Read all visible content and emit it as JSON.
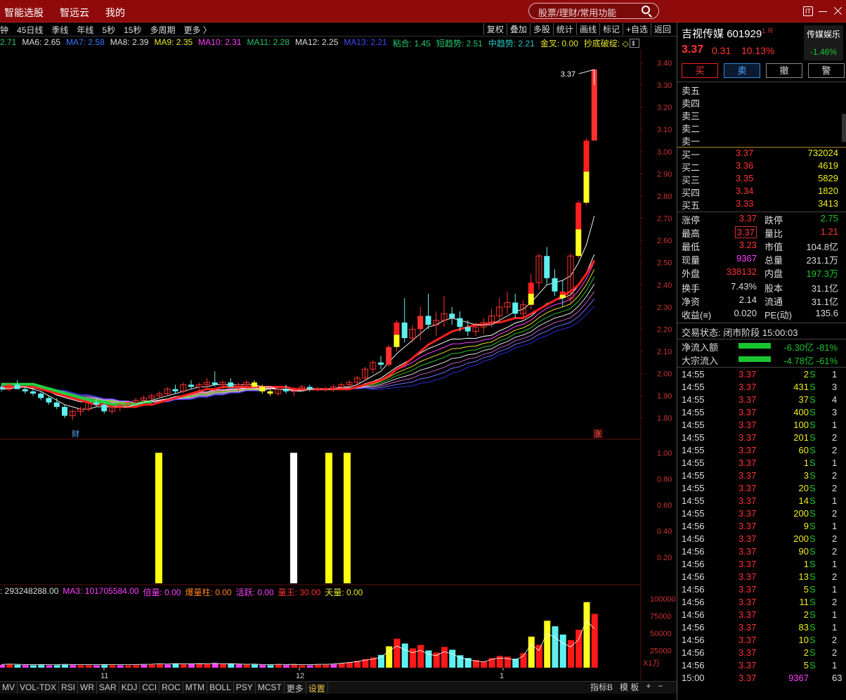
{
  "topbar": {
    "menu": [
      "智能选股",
      "智远云",
      "我的"
    ],
    "search_placeholder": "股票/理财/常用功能",
    "icon_label": "IT"
  },
  "chart_toolbar": {
    "left": [
      "钟",
      "45日线",
      "季线",
      "年线",
      "5秒",
      "15秒",
      "多周期",
      "更多 〉"
    ],
    "right": [
      "复权",
      "叠加",
      "多股",
      "统计",
      "画线",
      "标记",
      "+自选",
      "返回"
    ]
  },
  "ma_line": [
    {
      "text": "2.71",
      "color": "#27c56b"
    },
    {
      "text": "MA6: 2.65",
      "color": "#dddddd"
    },
    {
      "text": "MA7: 2.58",
      "color": "#3a78ff"
    },
    {
      "text": "MA8: 2.39",
      "color": "#dddddd"
    },
    {
      "text": "MA9: 2.35",
      "color": "#e8e830"
    },
    {
      "text": "MA10: 2.31",
      "color": "#ff40ff"
    },
    {
      "text": "MA11: 2.28",
      "color": "#27c56b"
    },
    {
      "text": "MA12: 2.25",
      "color": "#dddddd"
    },
    {
      "text": "MA13: 2.21",
      "color": "#3a4cff"
    },
    {
      "text": "粘合: 1.45",
      "color": "#27c56b"
    },
    {
      "text": "短趋势: 2.51",
      "color": "#27c56b"
    },
    {
      "text": "中趋势: 2.21",
      "color": "#27c5c5"
    },
    {
      "text": "金叉: 0.00",
      "color": "#e8e830"
    },
    {
      "text": "抄底破绽: ◇",
      "color": "#e8e830"
    }
  ],
  "price_axis": [
    "3.40",
    "3.30",
    "3.20",
    "3.10",
    "3.00",
    "2.90",
    "2.80",
    "2.70",
    "2.60",
    "2.50",
    "2.40",
    "2.30",
    "2.20",
    "2.10",
    "2.00",
    "1.90",
    "1.80"
  ],
  "signal_axis": [
    "1.00",
    "0.80",
    "0.60",
    "0.40",
    "0.20"
  ],
  "volume_axis": [
    "100000",
    "75000",
    "50000",
    "25000"
  ],
  "volume_unit": "X1万",
  "month_labels": [
    "11",
    "12",
    "1"
  ],
  "price_callout": "3.37",
  "badge_finance": "财",
  "badge_up": "涨",
  "indicator_line": [
    {
      "text": ": 293248288.00",
      "color": "#dddddd"
    },
    {
      "text": "MA3: 101705584.00",
      "color": "#ff40ff"
    },
    {
      "text": "倍量: 0.00",
      "color": "#ff40ff"
    },
    {
      "text": "爆量柱: 0.00",
      "color": "#ff8020"
    },
    {
      "text": "活跃: 0.00",
      "color": "#ff40ff"
    },
    {
      "text": "量王: 30.00",
      "color": "#ff3030"
    },
    {
      "text": "天量: 0.00",
      "color": "#e8e830"
    }
  ],
  "bottom_tabs": [
    "MV",
    "VOL-TDX",
    "RSI",
    "WR",
    "SAR",
    "KDJ",
    "CCI",
    "ROC",
    "MTM",
    "BOLL",
    "PSY",
    "MCST",
    "更多",
    "设置"
  ],
  "bottom_right": [
    "指标B",
    "模 板",
    "+",
    "−"
  ],
  "stock": {
    "name": "吉视传媒",
    "code": "601929",
    "flags": "L R",
    "price": "3.37",
    "change": "0.31",
    "change_pct": "10.13%",
    "sector_name": "传媒娱乐",
    "sector_pct": "-1.46%"
  },
  "trade_buttons": [
    "买",
    "卖",
    "撤",
    "警"
  ],
  "asks": [
    {
      "label": "卖五",
      "price": "",
      "vol": ""
    },
    {
      "label": "卖四",
      "price": "",
      "vol": ""
    },
    {
      "label": "卖三",
      "price": "",
      "vol": ""
    },
    {
      "label": "卖二",
      "price": "",
      "vol": ""
    },
    {
      "label": "卖一",
      "price": "",
      "vol": ""
    }
  ],
  "bids": [
    {
      "label": "买一",
      "price": "3.37",
      "vol": "732024"
    },
    {
      "label": "买二",
      "price": "3.36",
      "vol": "4619"
    },
    {
      "label": "买三",
      "price": "3.35",
      "vol": "5829"
    },
    {
      "label": "买四",
      "price": "3.34",
      "vol": "1820"
    },
    {
      "label": "买五",
      "price": "3.33",
      "vol": "3413"
    }
  ],
  "stats": [
    {
      "a": "涨停",
      "av": "3.37",
      "ac": "#ff3333",
      "b": "跌停",
      "bv": "2.75",
      "bc": "#19c52f"
    },
    {
      "a": "最高",
      "av": "3.37",
      "ac": "#ff3333",
      "b": "量比",
      "bv": "1.21",
      "bc": "#ff3333"
    },
    {
      "a": "最低",
      "av": "3.23",
      "ac": "#ff3333",
      "b": "市值",
      "bv": "104.8亿",
      "bc": "#dddddd"
    },
    {
      "a": "现量",
      "av": "9367",
      "ac": "#ff40ff",
      "b": "总量",
      "bv": "231.1万",
      "bc": "#dddddd"
    },
    {
      "a": "外盘",
      "av": "338132",
      "ac": "#ff3333",
      "b": "内盘",
      "bv": "197.3万",
      "bc": "#19c52f"
    },
    {
      "a": "换手",
      "av": "7.43%",
      "ac": "#dddddd",
      "b": "股本",
      "bv": "31.1亿",
      "bc": "#dddddd"
    },
    {
      "a": "净资",
      "av": "2.14",
      "ac": "#dddddd",
      "b": "流通",
      "bv": "31.1亿",
      "bc": "#dddddd"
    },
    {
      "a": "收益(≡)",
      "av": "0.020",
      "ac": "#dddddd",
      "b": "PE(动)",
      "bv": "135.6",
      "bc": "#dddddd"
    }
  ],
  "trade_status": "交易状态: 闭市阶段 15:00:03",
  "flows": [
    {
      "label": "净流入额",
      "value": "-6.30亿 -81%"
    },
    {
      "label": "大宗流入",
      "value": "-4.78亿 -61%"
    }
  ],
  "ticks": [
    {
      "t": "14:55",
      "p": "3.37",
      "v": "2",
      "s": "S",
      "c": "1"
    },
    {
      "t": "14:55",
      "p": "3.37",
      "v": "431",
      "s": "S",
      "c": "3"
    },
    {
      "t": "14:55",
      "p": "3.37",
      "v": "37",
      "s": "S",
      "c": "4"
    },
    {
      "t": "14:55",
      "p": "3.37",
      "v": "400",
      "s": "S",
      "c": "3"
    },
    {
      "t": "14:55",
      "p": "3.37",
      "v": "100",
      "s": "S",
      "c": "1"
    },
    {
      "t": "14:55",
      "p": "3.37",
      "v": "201",
      "s": "S",
      "c": "2"
    },
    {
      "t": "14:55",
      "p": "3.37",
      "v": "60",
      "s": "S",
      "c": "2"
    },
    {
      "t": "14:55",
      "p": "3.37",
      "v": "1",
      "s": "S",
      "c": "1"
    },
    {
      "t": "14:55",
      "p": "3.37",
      "v": "3",
      "s": "S",
      "c": "2"
    },
    {
      "t": "14:55",
      "p": "3.37",
      "v": "20",
      "s": "S",
      "c": "2"
    },
    {
      "t": "14:55",
      "p": "3.37",
      "v": "14",
      "s": "S",
      "c": "1"
    },
    {
      "t": "14:55",
      "p": "3.37",
      "v": "200",
      "s": "S",
      "c": "2"
    },
    {
      "t": "14:56",
      "p": "3.37",
      "v": "9",
      "s": "S",
      "c": "1"
    },
    {
      "t": "14:56",
      "p": "3.37",
      "v": "200",
      "s": "S",
      "c": "2"
    },
    {
      "t": "14:56",
      "p": "3.37",
      "v": "90",
      "s": "S",
      "c": "2"
    },
    {
      "t": "14:56",
      "p": "3.37",
      "v": "1",
      "s": "S",
      "c": "1"
    },
    {
      "t": "14:56",
      "p": "3.37",
      "v": "13",
      "s": "S",
      "c": "2"
    },
    {
      "t": "14:56",
      "p": "3.37",
      "v": "5",
      "s": "S",
      "c": "1"
    },
    {
      "t": "14:56",
      "p": "3.37",
      "v": "11",
      "s": "S",
      "c": "2"
    },
    {
      "t": "14:56",
      "p": "3.37",
      "v": "2",
      "s": "S",
      "c": "1"
    },
    {
      "t": "14:56",
      "p": "3.37",
      "v": "83",
      "s": "S",
      "c": "1"
    },
    {
      "t": "14:56",
      "p": "3.37",
      "v": "10",
      "s": "S",
      "c": "2"
    },
    {
      "t": "14:56",
      "p": "3.37",
      "v": "2",
      "s": "S",
      "c": "2"
    },
    {
      "t": "14:56",
      "p": "3.37",
      "v": "5",
      "s": "S",
      "c": "1"
    },
    {
      "t": "15:00",
      "p": "3.37",
      "v": "9367",
      "s": "",
      "c": "63"
    }
  ],
  "colors": {
    "up": "#ff3333",
    "down": "#19c52f",
    "cyan_candle": "#5ef0f0",
    "yellow_candle": "#ffff20",
    "topbar": "#8f0b0b"
  },
  "chart_data": {
    "type": "candlestick",
    "price_range": [
      1.72,
      3.43
    ],
    "signal_range": [
      0,
      1.05
    ],
    "volume_range": [
      0,
      110000
    ],
    "candles": [
      [
        1.94,
        1.95,
        1.92,
        1.93
      ],
      [
        1.93,
        1.96,
        1.92,
        1.95
      ],
      [
        1.95,
        1.97,
        1.93,
        1.93
      ],
      [
        1.93,
        1.94,
        1.91,
        1.92
      ],
      [
        1.92,
        1.93,
        1.9,
        1.91
      ],
      [
        1.91,
        1.92,
        1.88,
        1.89
      ],
      [
        1.89,
        1.9,
        1.86,
        1.87
      ],
      [
        1.87,
        1.89,
        1.84,
        1.85
      ],
      [
        1.85,
        1.86,
        1.8,
        1.81
      ],
      [
        1.81,
        1.84,
        1.79,
        1.83
      ],
      [
        1.83,
        1.85,
        1.81,
        1.84
      ],
      [
        1.84,
        1.88,
        1.83,
        1.87
      ],
      [
        1.87,
        1.89,
        1.85,
        1.86
      ],
      [
        1.86,
        1.87,
        1.82,
        1.83
      ],
      [
        1.83,
        1.86,
        1.82,
        1.85
      ],
      [
        1.85,
        1.87,
        1.83,
        1.86
      ],
      [
        1.86,
        1.88,
        1.85,
        1.87
      ],
      [
        1.87,
        1.89,
        1.86,
        1.88
      ],
      [
        1.88,
        1.9,
        1.87,
        1.89
      ],
      [
        1.89,
        1.91,
        1.88,
        1.9
      ],
      [
        1.9,
        1.92,
        1.89,
        1.91
      ],
      [
        1.91,
        1.94,
        1.9,
        1.93
      ],
      [
        1.93,
        1.95,
        1.91,
        1.92
      ],
      [
        1.92,
        1.96,
        1.91,
        1.95
      ],
      [
        1.95,
        1.97,
        1.93,
        1.94
      ],
      [
        1.94,
        1.96,
        1.92,
        1.95
      ],
      [
        1.95,
        1.98,
        1.93,
        1.96
      ],
      [
        1.96,
        2.01,
        1.94,
        1.95
      ],
      [
        1.95,
        1.97,
        1.93,
        1.96
      ],
      [
        1.96,
        1.98,
        1.94,
        1.94
      ],
      [
        1.94,
        1.96,
        1.92,
        1.95
      ],
      [
        1.95,
        1.97,
        1.93,
        1.96
      ],
      [
        1.96,
        1.97,
        1.94,
        1.94
      ],
      [
        1.94,
        1.95,
        1.91,
        1.92
      ],
      [
        1.92,
        1.93,
        1.9,
        1.91
      ],
      [
        1.91,
        1.94,
        1.9,
        1.93
      ],
      [
        1.93,
        1.95,
        1.91,
        1.92
      ],
      [
        1.92,
        1.94,
        1.9,
        1.93
      ],
      [
        1.93,
        1.95,
        1.92,
        1.94
      ],
      [
        1.94,
        1.95,
        1.92,
        1.93
      ],
      [
        1.93,
        1.94,
        1.92,
        1.93
      ],
      [
        1.93,
        1.94,
        1.92,
        1.93
      ],
      [
        1.93,
        1.95,
        1.92,
        1.94
      ],
      [
        1.94,
        1.96,
        1.93,
        1.95
      ],
      [
        1.95,
        1.97,
        1.94,
        1.96
      ],
      [
        1.96,
        1.99,
        1.95,
        1.98
      ],
      [
        1.98,
        2.03,
        1.97,
        2.02
      ],
      [
        2.02,
        2.06,
        2.0,
        2.05
      ],
      [
        2.05,
        2.08,
        2.02,
        2.04
      ],
      [
        2.04,
        2.13,
        2.03,
        2.12
      ],
      [
        2.12,
        2.24,
        2.1,
        2.23
      ],
      [
        2.23,
        2.34,
        2.14,
        2.16
      ],
      [
        2.16,
        2.22,
        2.14,
        2.2
      ],
      [
        2.2,
        2.3,
        2.15,
        2.26
      ],
      [
        2.26,
        2.36,
        2.2,
        2.22
      ],
      [
        2.22,
        2.28,
        2.17,
        2.24
      ],
      [
        2.24,
        2.35,
        2.21,
        2.27
      ],
      [
        2.27,
        2.3,
        2.22,
        2.25
      ],
      [
        2.25,
        2.28,
        2.19,
        2.21
      ],
      [
        2.21,
        2.24,
        2.17,
        2.19
      ],
      [
        2.19,
        2.23,
        2.17,
        2.21
      ],
      [
        2.21,
        2.25,
        2.18,
        2.23
      ],
      [
        2.23,
        2.29,
        2.21,
        2.26
      ],
      [
        2.26,
        2.34,
        2.23,
        2.3
      ],
      [
        2.3,
        2.37,
        2.27,
        2.32
      ],
      [
        2.32,
        2.36,
        2.25,
        2.27
      ],
      [
        2.27,
        2.33,
        2.25,
        2.31
      ],
      [
        2.31,
        2.45,
        2.29,
        2.41
      ],
      [
        2.41,
        2.54,
        2.38,
        2.53
      ],
      [
        2.53,
        2.57,
        2.4,
        2.43
      ],
      [
        2.43,
        2.47,
        2.35,
        2.37
      ],
      [
        2.37,
        2.42,
        2.3,
        2.34
      ],
      [
        2.34,
        2.54,
        2.32,
        2.53
      ],
      [
        2.53,
        2.78,
        2.52,
        2.77
      ],
      [
        2.77,
        3.06,
        2.76,
        3.05
      ],
      [
        3.05,
        3.37,
        3.23,
        3.37
      ]
    ],
    "ma_series": [
      {
        "name": "MA5",
        "values": [
          1.93,
          1.93,
          1.94,
          1.94,
          1.93,
          1.92,
          1.9,
          1.88,
          1.86,
          1.85,
          1.84,
          1.84,
          1.85,
          1.85,
          1.85,
          1.85,
          1.85,
          1.86,
          1.87,
          1.88,
          1.89,
          1.9,
          1.91,
          1.92,
          1.93,
          1.94,
          1.94,
          1.95,
          1.95,
          1.95,
          1.95,
          1.95,
          1.95,
          1.94,
          1.94,
          1.93,
          1.93,
          1.92,
          1.92,
          1.93,
          1.93,
          1.93,
          1.93,
          1.94,
          1.94,
          1.95,
          1.97,
          1.99,
          2.01,
          2.05,
          2.09,
          2.12,
          2.15,
          2.18,
          2.21,
          2.22,
          2.24,
          2.25,
          2.24,
          2.23,
          2.22,
          2.22,
          2.22,
          2.24,
          2.26,
          2.28,
          2.29,
          2.32,
          2.36,
          2.4,
          2.41,
          2.42,
          2.44,
          2.5,
          2.58,
          2.71
        ]
      },
      {
        "name": "MA10",
        "values": [
          1.94,
          1.94,
          1.94,
          1.94,
          1.94,
          1.93,
          1.92,
          1.91,
          1.9,
          1.89,
          1.88,
          1.87,
          1.86,
          1.86,
          1.85,
          1.85,
          1.85,
          1.85,
          1.86,
          1.86,
          1.87,
          1.88,
          1.89,
          1.9,
          1.91,
          1.92,
          1.93,
          1.93,
          1.94,
          1.94,
          1.94,
          1.94,
          1.94,
          1.94,
          1.94,
          1.94,
          1.94,
          1.93,
          1.93,
          1.93,
          1.93,
          1.93,
          1.93,
          1.93,
          1.93,
          1.94,
          1.95,
          1.96,
          1.97,
          1.99,
          2.02,
          2.04,
          2.07,
          2.1,
          2.13,
          2.15,
          2.17,
          2.19,
          2.2,
          2.21,
          2.22,
          2.22,
          2.23,
          2.23,
          2.24,
          2.25,
          2.25,
          2.27,
          2.29,
          2.31,
          2.33,
          2.35,
          2.37,
          2.4,
          2.45,
          2.51
        ]
      },
      {
        "name": "MA20",
        "values": [
          1.94,
          1.94,
          1.94,
          1.94,
          1.94,
          1.94,
          1.94,
          1.93,
          1.93,
          1.92,
          1.91,
          1.91,
          1.9,
          1.89,
          1.89,
          1.88,
          1.88,
          1.87,
          1.87,
          1.87,
          1.87,
          1.87,
          1.88,
          1.88,
          1.88,
          1.89,
          1.89,
          1.9,
          1.9,
          1.91,
          1.91,
          1.92,
          1.92,
          1.92,
          1.93,
          1.93,
          1.93,
          1.93,
          1.93,
          1.93,
          1.93,
          1.93,
          1.93,
          1.93,
          1.93,
          1.93,
          1.94,
          1.94,
          1.95,
          1.96,
          1.97,
          1.98,
          1.99,
          2.01,
          2.02,
          2.04,
          2.05,
          2.07,
          2.08,
          2.1,
          2.11,
          2.13,
          2.14,
          2.16,
          2.17,
          2.19,
          2.2,
          2.21,
          2.23,
          2.24,
          2.26,
          2.27,
          2.28,
          2.3,
          2.33,
          2.36
        ]
      }
    ],
    "signal_bars": [
      {
        "index": 17,
        "value": 1.0,
        "color": "yellow"
      },
      {
        "index": 32,
        "value": 1.0,
        "color": "white"
      },
      {
        "index": 36,
        "value": 1.0,
        "color": "yellow"
      },
      {
        "index": 38,
        "value": 1.0,
        "color": "yellow"
      }
    ],
    "volumes": [
      4000,
      4500,
      4200,
      3800,
      3600,
      3900,
      3500,
      3700,
      4200,
      3800,
      3600,
      3400,
      3500,
      3900,
      3700,
      3600,
      3500,
      3800,
      4100,
      4400,
      5200,
      4600,
      5800,
      4800,
      5100,
      5600,
      5300,
      6200,
      5000,
      5400,
      4700,
      4300,
      4500,
      3900,
      3700,
      4200,
      3800,
      4100,
      3600,
      3500,
      4100,
      4300,
      4700,
      6200,
      7800,
      9800,
      12500,
      14800,
      18500,
      31000,
      42000,
      35000,
      28000,
      33000,
      25000,
      22000,
      30000,
      26000,
      18000,
      14000,
      11000,
      9000,
      14000,
      17000,
      16000,
      13000,
      21000,
      45000,
      33000,
      68000,
      60000,
      48000,
      40000,
      55000,
      95000,
      78000
    ]
  }
}
